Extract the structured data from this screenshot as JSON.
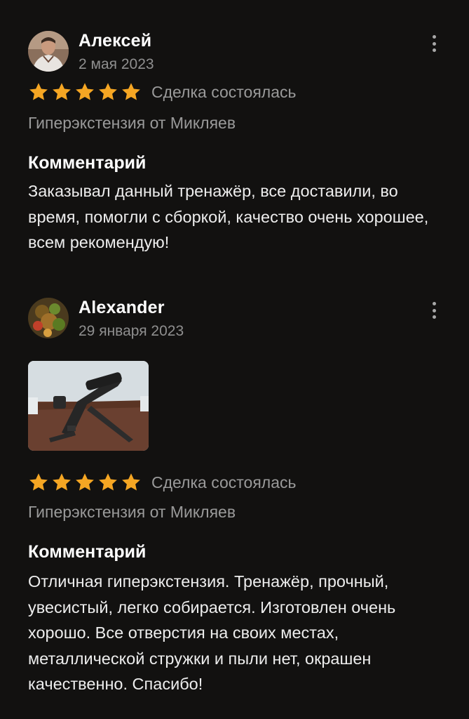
{
  "reviews": [
    {
      "author": "Алексей",
      "date": "2 мая 2023",
      "rating": 5,
      "deal_status": "Сделка состоялась",
      "product": "Гиперэкстензия от Микляев",
      "comment_title": "Комментарий",
      "comment": "Заказывал данный тренажёр, все доставили, во время, помогли с сборкой, качество очень хорошее, всем рекомендую!"
    },
    {
      "author": "Alexander",
      "date": "29 января 2023",
      "rating": 5,
      "deal_status": "Сделка состоялась",
      "product": "Гиперэкстензия от Микляев",
      "comment_title": "Комментарий",
      "comment": "Отличная гиперэкстензия. Тренажёр, прочный, увесистый, легко собирается. Изготовлен очень хорошо. Все отверстия на своих местах, металлической стружки и пыли нет, окрашен качественно. Спасибо!"
    }
  ],
  "colors": {
    "background": "#121110",
    "star": "#f5a623",
    "muted_text": "#9a9a9a"
  },
  "icons": {
    "menu": "more-vertical-icon",
    "star": "star-icon"
  }
}
